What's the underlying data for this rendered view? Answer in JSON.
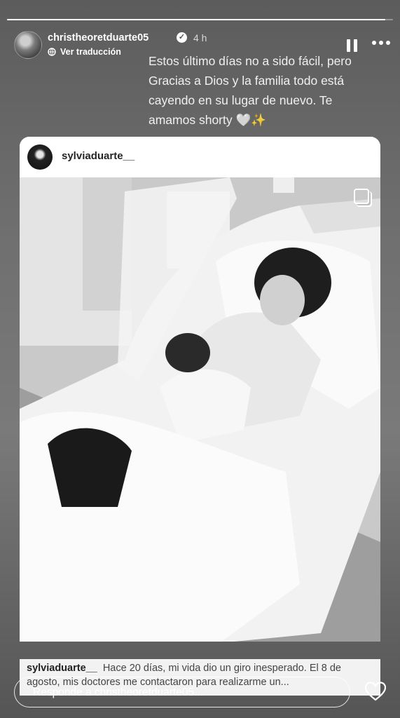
{
  "story": {
    "progress_fraction": 0.98,
    "username": "christheoretduarte05",
    "time": "4 h",
    "translate_label": "Ver traducción",
    "caption": "Estos último días no a sido fácil, pero\nGracias a Dios y la familia todo está\ncayendo en su lugar de nuevo. Te\namamos shorty 🤍✨"
  },
  "post": {
    "username": "sylviaduarte__",
    "text_user": "sylviaduarte__",
    "text": "Hace 20 días, mi vida dio un giro inesperado. El 8 de agosto, mis doctores me contactaron para realizarme un..."
  },
  "reply": {
    "placeholder": "Responde a christheoretduarte05..."
  },
  "icons": {
    "verified": "verified-badge-icon",
    "globe": "globe-icon",
    "pause": "pause-icon",
    "more": "more-options-icon",
    "multi": "multiple-photos-icon",
    "heart": "heart-icon"
  }
}
